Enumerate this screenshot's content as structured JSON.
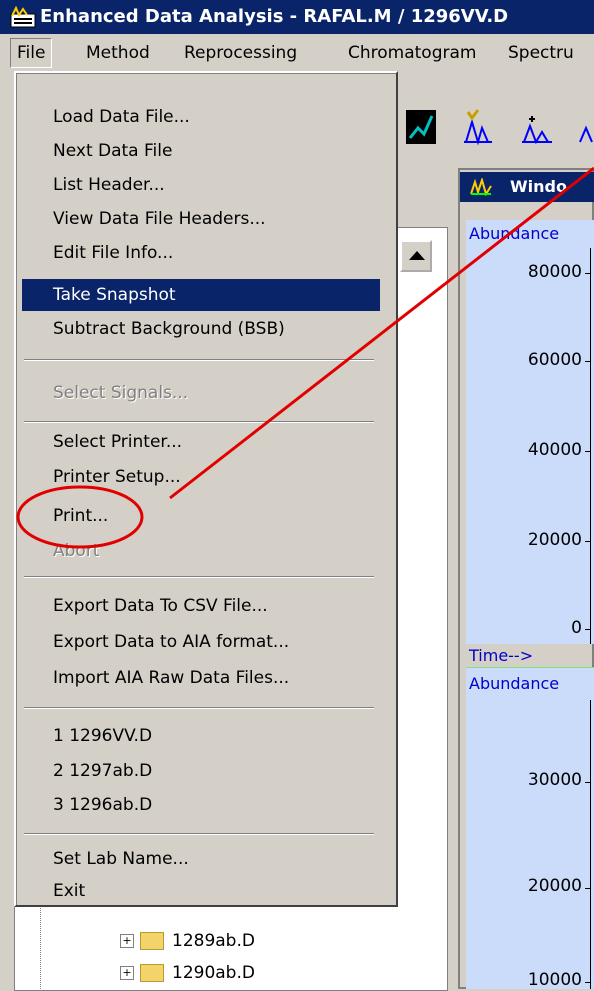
{
  "window": {
    "title": "Enhanced Data Analysis - RAFAL.M / 1296VV.D"
  },
  "menubar": {
    "items": [
      {
        "label": "File",
        "active": true
      },
      {
        "label": "Method"
      },
      {
        "label": "Reprocessing"
      },
      {
        "label": "Chromatogram"
      },
      {
        "label": "Spectru"
      }
    ]
  },
  "file_menu": {
    "items": [
      {
        "label": "Load Data File...",
        "state": "normal"
      },
      {
        "label": "Next Data File",
        "state": "normal"
      },
      {
        "label": "List Header...",
        "state": "normal"
      },
      {
        "label": "View Data File Headers...",
        "state": "normal"
      },
      {
        "label": "Edit File Info...",
        "state": "normal"
      },
      {
        "label": "Take Snapshot",
        "state": "highlighted"
      },
      {
        "label": "Subtract Background (BSB)",
        "state": "normal"
      },
      {
        "label": "Select Signals...",
        "state": "disabled"
      },
      {
        "label": "Select Printer...",
        "state": "normal"
      },
      {
        "label": "Printer Setup...",
        "state": "normal"
      },
      {
        "label": "Print...",
        "state": "normal"
      },
      {
        "label": "Abort",
        "state": "disabled"
      },
      {
        "label": "Export Data To CSV File...",
        "state": "normal"
      },
      {
        "label": "Export Data to AIA format...",
        "state": "normal"
      },
      {
        "label": "Import AIA Raw Data Files...",
        "state": "normal"
      },
      {
        "label": "1  1296VV.D",
        "state": "normal"
      },
      {
        "label": "2  1297ab.D",
        "state": "normal"
      },
      {
        "label": "3  1296ab.D",
        "state": "normal"
      },
      {
        "label": "Set Lab Name...",
        "state": "normal"
      },
      {
        "label": "Exit",
        "state": "normal"
      }
    ]
  },
  "tree": {
    "items": [
      {
        "label": "1289ab.D"
      },
      {
        "label": "1290ab.D"
      }
    ]
  },
  "chart_window": {
    "title": "Windo",
    "plot1": {
      "ylabel": "Abundance",
      "ticks": [
        "80000",
        "60000",
        "40000",
        "20000",
        "0"
      ],
      "xlabel": "Time-->"
    },
    "plot2": {
      "ylabel": "Abundance",
      "ticks": [
        "30000",
        "20000",
        "10000"
      ]
    }
  },
  "colors": {
    "titlebar": "#0a246a",
    "highlight": "#0a246a",
    "plot_bg": "#cbdcfb",
    "annotation": "#e00000"
  }
}
